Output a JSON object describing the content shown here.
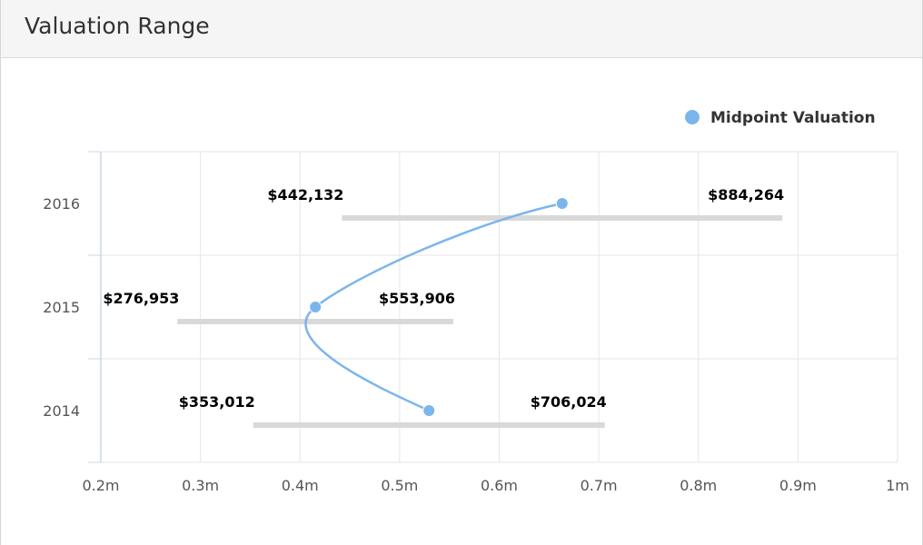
{
  "panel": {
    "title": "Valuation Range"
  },
  "colors": {
    "series": "#7cb5ec",
    "range_bar": "#d9d9d9",
    "grid": "#e6e6e6",
    "axis": "#ccd6eb"
  },
  "chart_data": {
    "type": "columnrange-spline",
    "title": "",
    "xlabel": "",
    "ylabel": "",
    "categories": [
      "2016",
      "2015",
      "2014"
    ],
    "x_ticks": [
      "0.2m",
      "0.3m",
      "0.4m",
      "0.5m",
      "0.6m",
      "0.7m",
      "0.8m",
      "0.9m",
      "1m"
    ],
    "xlim": [
      200000,
      1000000
    ],
    "grid": true,
    "legend": {
      "position": "top-right",
      "entries": [
        "Midpoint Valuation"
      ]
    },
    "ranges": [
      {
        "category": "2016",
        "low": 442132,
        "high": 884264,
        "low_label": "$442,132",
        "high_label": "$884,264"
      },
      {
        "category": "2015",
        "low": 276953,
        "high": 553906,
        "low_label": "$276,953",
        "high_label": "$553,906"
      },
      {
        "category": "2014",
        "low": 353012,
        "high": 706024,
        "low_label": "$353,012",
        "high_label": "$706,024"
      }
    ],
    "series": [
      {
        "name": "Midpoint Valuation",
        "values": [
          663198,
          415430,
          529518
        ]
      }
    ]
  }
}
